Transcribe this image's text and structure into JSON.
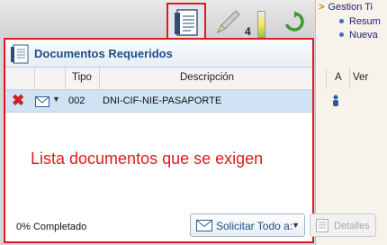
{
  "toolbar": {
    "count_badge": "4",
    "icons": [
      "document-list-icon",
      "pencil-icon",
      "gauge-icon",
      "refresh-icon"
    ]
  },
  "tree": {
    "root_label": "Gestion Ti",
    "items": [
      "Resum",
      "Nueva"
    ]
  },
  "dialog": {
    "title": "Documentos Requeridos",
    "columns": [
      "Tipo",
      "Descripción",
      "A",
      "Ver"
    ],
    "rows": [
      {
        "tipo": "002",
        "descripcion": "DNI-CIF-NIE-PASAPORTE"
      }
    ],
    "annotation": "Lista documentos que se exigen",
    "status": "0% Completado",
    "solicitar_label": "Solicitar Todo a:",
    "detalles_label": "Detalles"
  },
  "colors": {
    "highlight": "#e2191b",
    "title": "#1f4f86",
    "selected_row": "#cfe3f5"
  }
}
